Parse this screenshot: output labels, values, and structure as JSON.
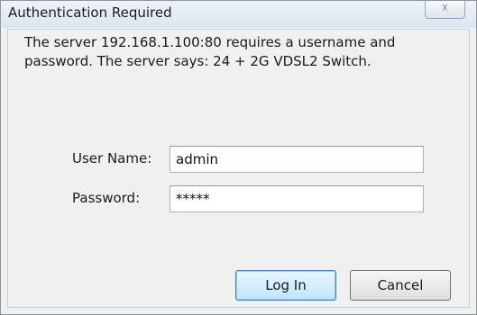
{
  "window": {
    "title": "Authentication Required",
    "close_glyph": "☓"
  },
  "message": "The server 192.168.1.100:80 requires a username and password. The server says: 24 + 2G VDSL2 Switch.",
  "form": {
    "username_label": "User Name:",
    "username_value": "admin",
    "password_label": "Password:",
    "password_value": "*****"
  },
  "buttons": {
    "login_label": "Log In",
    "cancel_label": "Cancel"
  }
}
